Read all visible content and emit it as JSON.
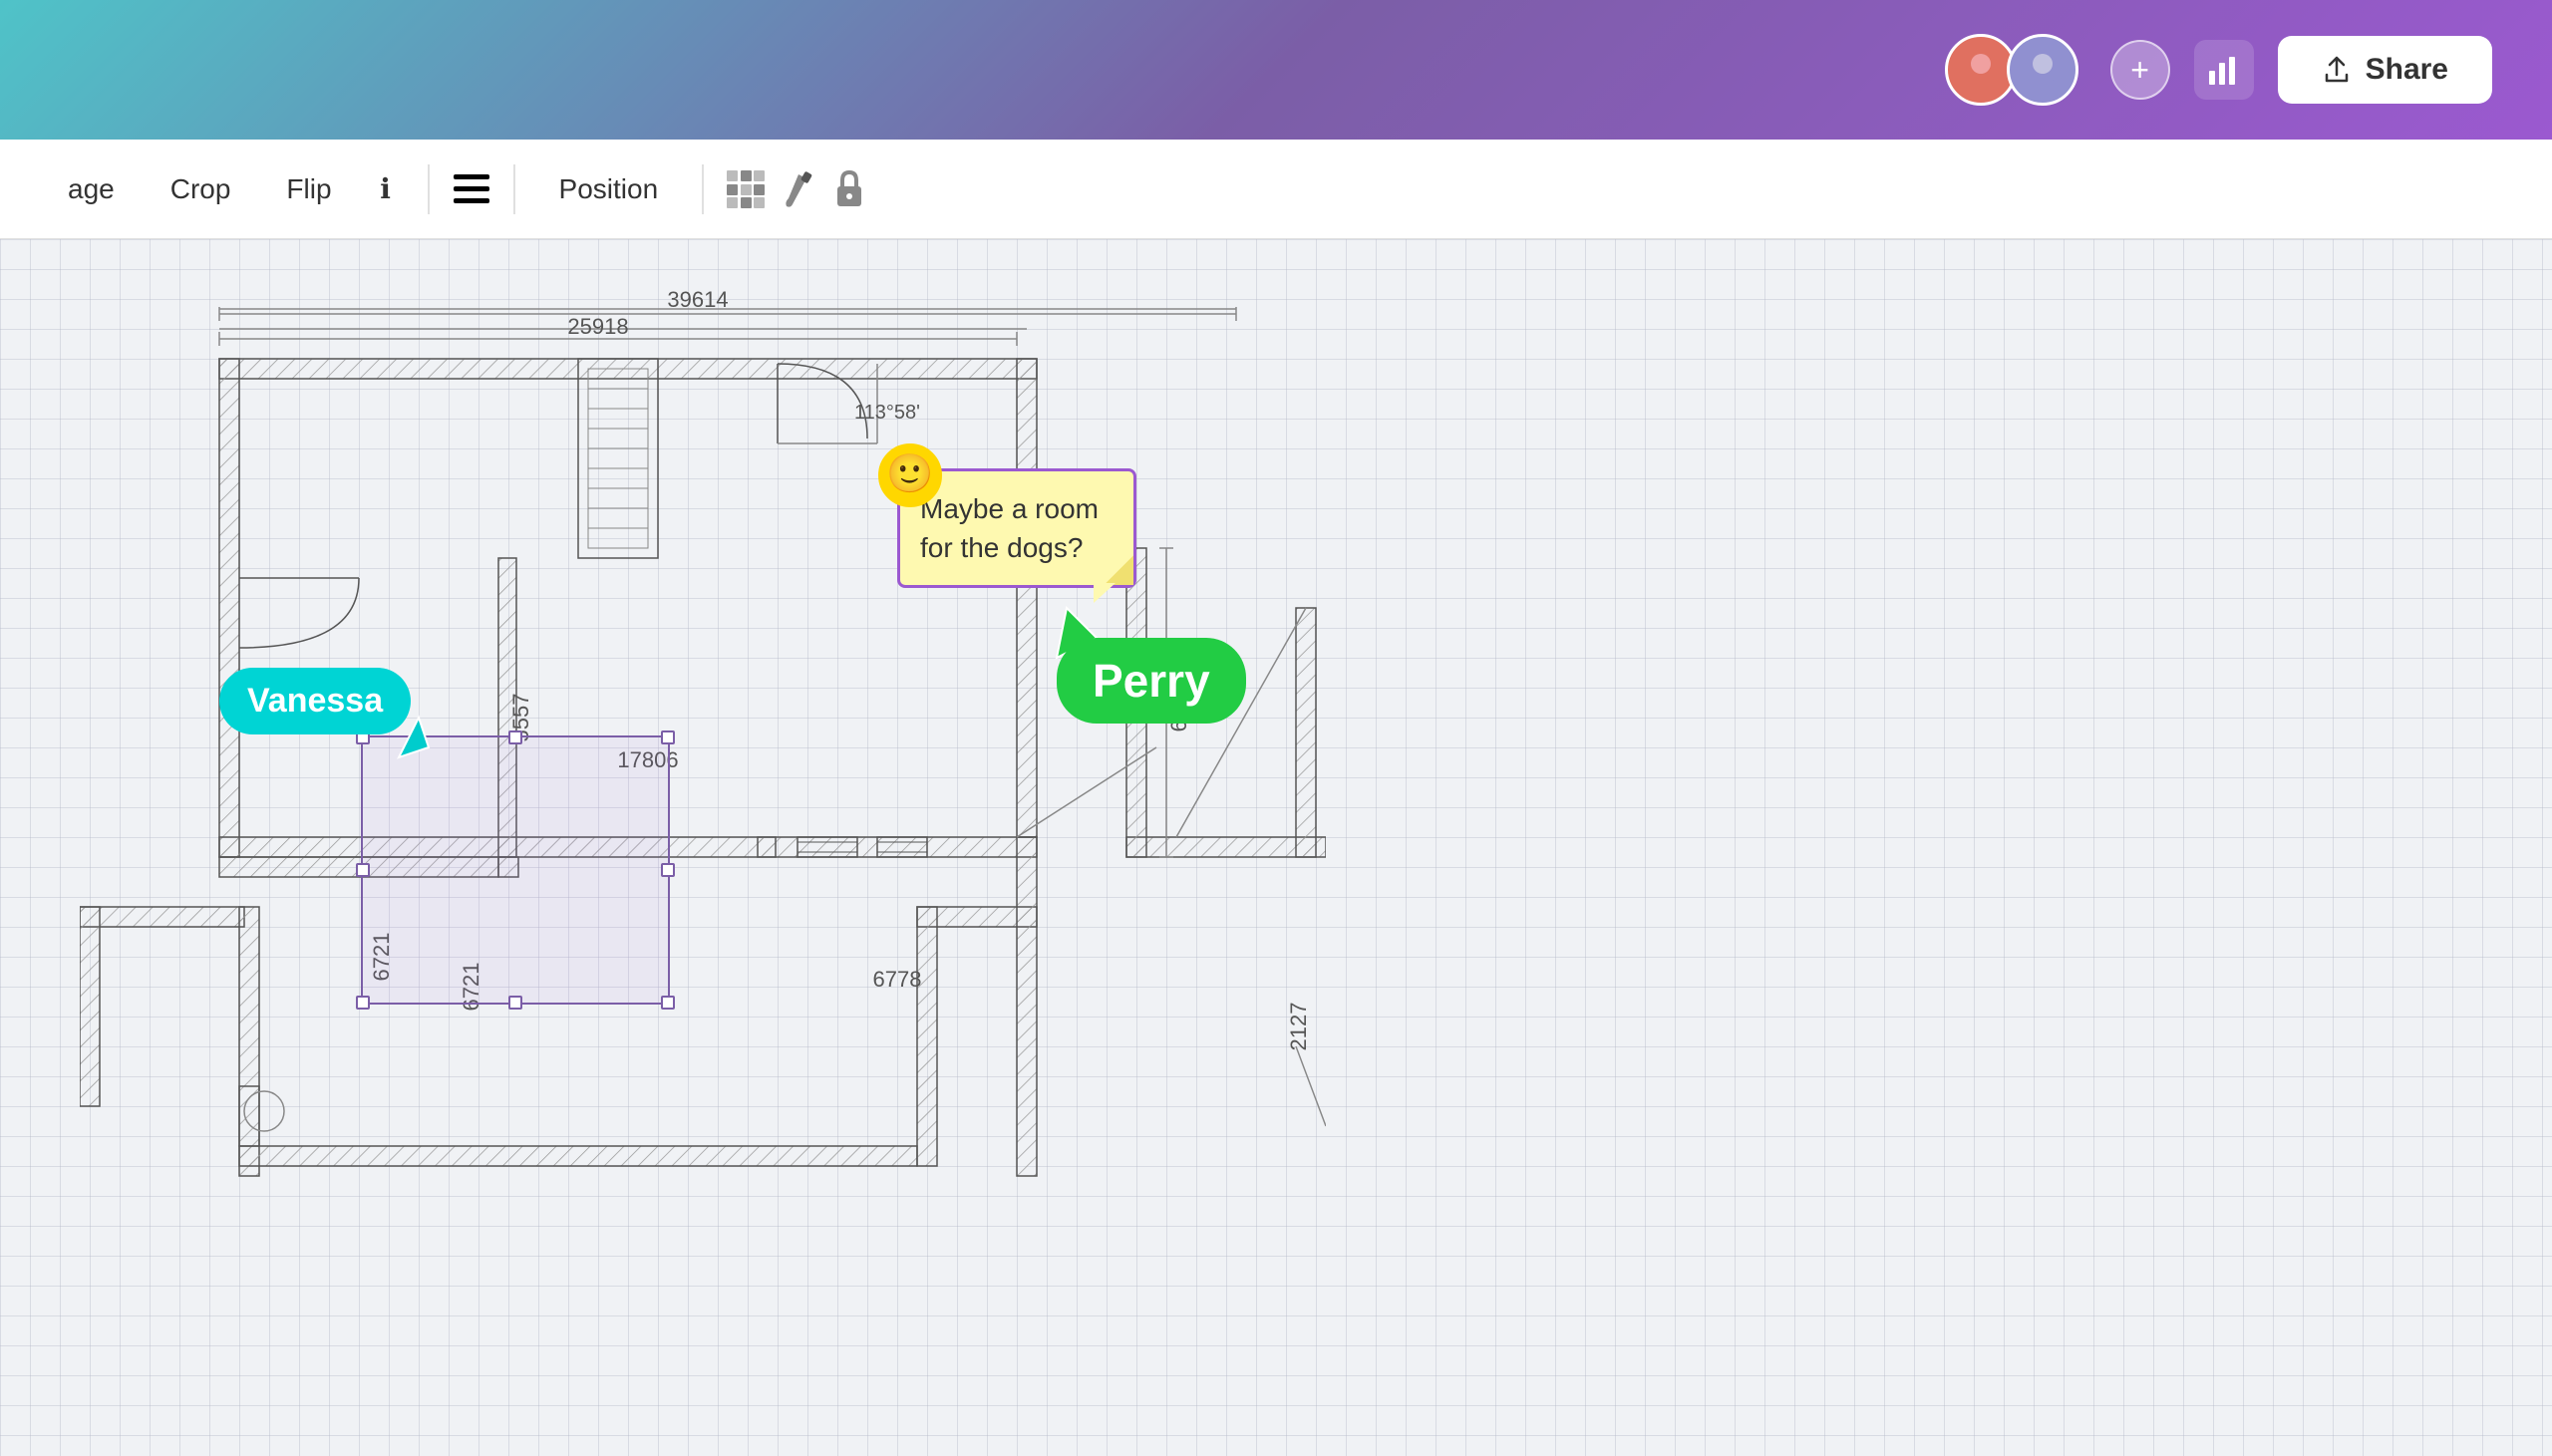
{
  "header": {
    "share_label": "Share",
    "add_collaborator_label": "+",
    "avatar1_initials": "👤",
    "avatar2_initials": "👤"
  },
  "toolbar": {
    "image_label": "age",
    "crop_label": "Crop",
    "flip_label": "Flip",
    "position_label": "Position",
    "info_icon": "ℹ",
    "menu_icon": "≡",
    "grid_icon": "⣿",
    "paint_icon": "🖌",
    "lock_icon": "🔒"
  },
  "canvas": {
    "dimension1": "39614",
    "dimension2": "25918",
    "dimension3": "113°58'",
    "dimension4": "5557",
    "dimension5": "17806",
    "dimension6": "6721",
    "dimension7": "6721",
    "dimension8": "6778",
    "dimension9": "6303",
    "dimension10": "2127",
    "vanessa_label": "Vanessa",
    "perry_label": "Perry",
    "sticky_note_text": "Maybe a room for the dogs?",
    "sticky_emoji": "🙂"
  }
}
